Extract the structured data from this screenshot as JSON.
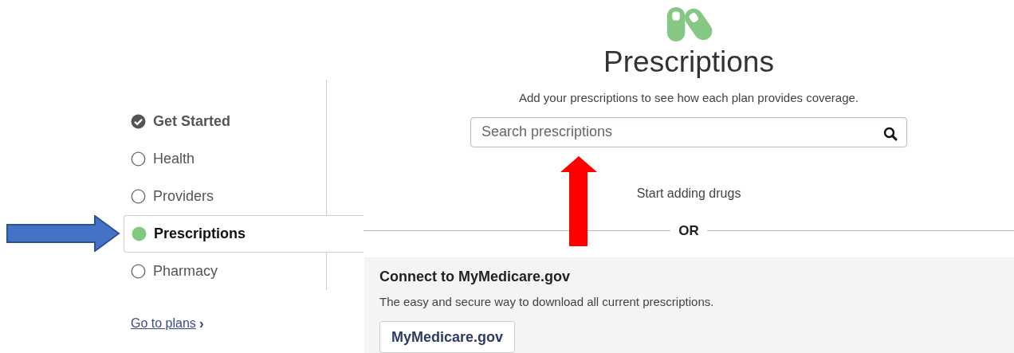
{
  "steps": [
    {
      "label": "Get Started",
      "kind": "done",
      "selected": false
    },
    {
      "label": "Health",
      "kind": "todo",
      "selected": false
    },
    {
      "label": "Providers",
      "kind": "todo",
      "selected": false
    },
    {
      "label": "Prescriptions",
      "kind": "current",
      "selected": true
    },
    {
      "label": "Pharmacy",
      "kind": "todo",
      "selected": false
    }
  ],
  "go_to_plans": {
    "label": "Go to plans",
    "chevron": "›"
  },
  "header": {
    "title": "Prescriptions",
    "subtitle": "Add your prescriptions to see how each plan provides coverage."
  },
  "search": {
    "placeholder": "Search prescriptions"
  },
  "start_text": "Start adding drugs",
  "divider_text": "OR",
  "connect_panel": {
    "title": "Connect to MyMedicare.gov",
    "text": "The easy and secure way to download all current prescriptions.",
    "button": "MyMedicare.gov"
  }
}
